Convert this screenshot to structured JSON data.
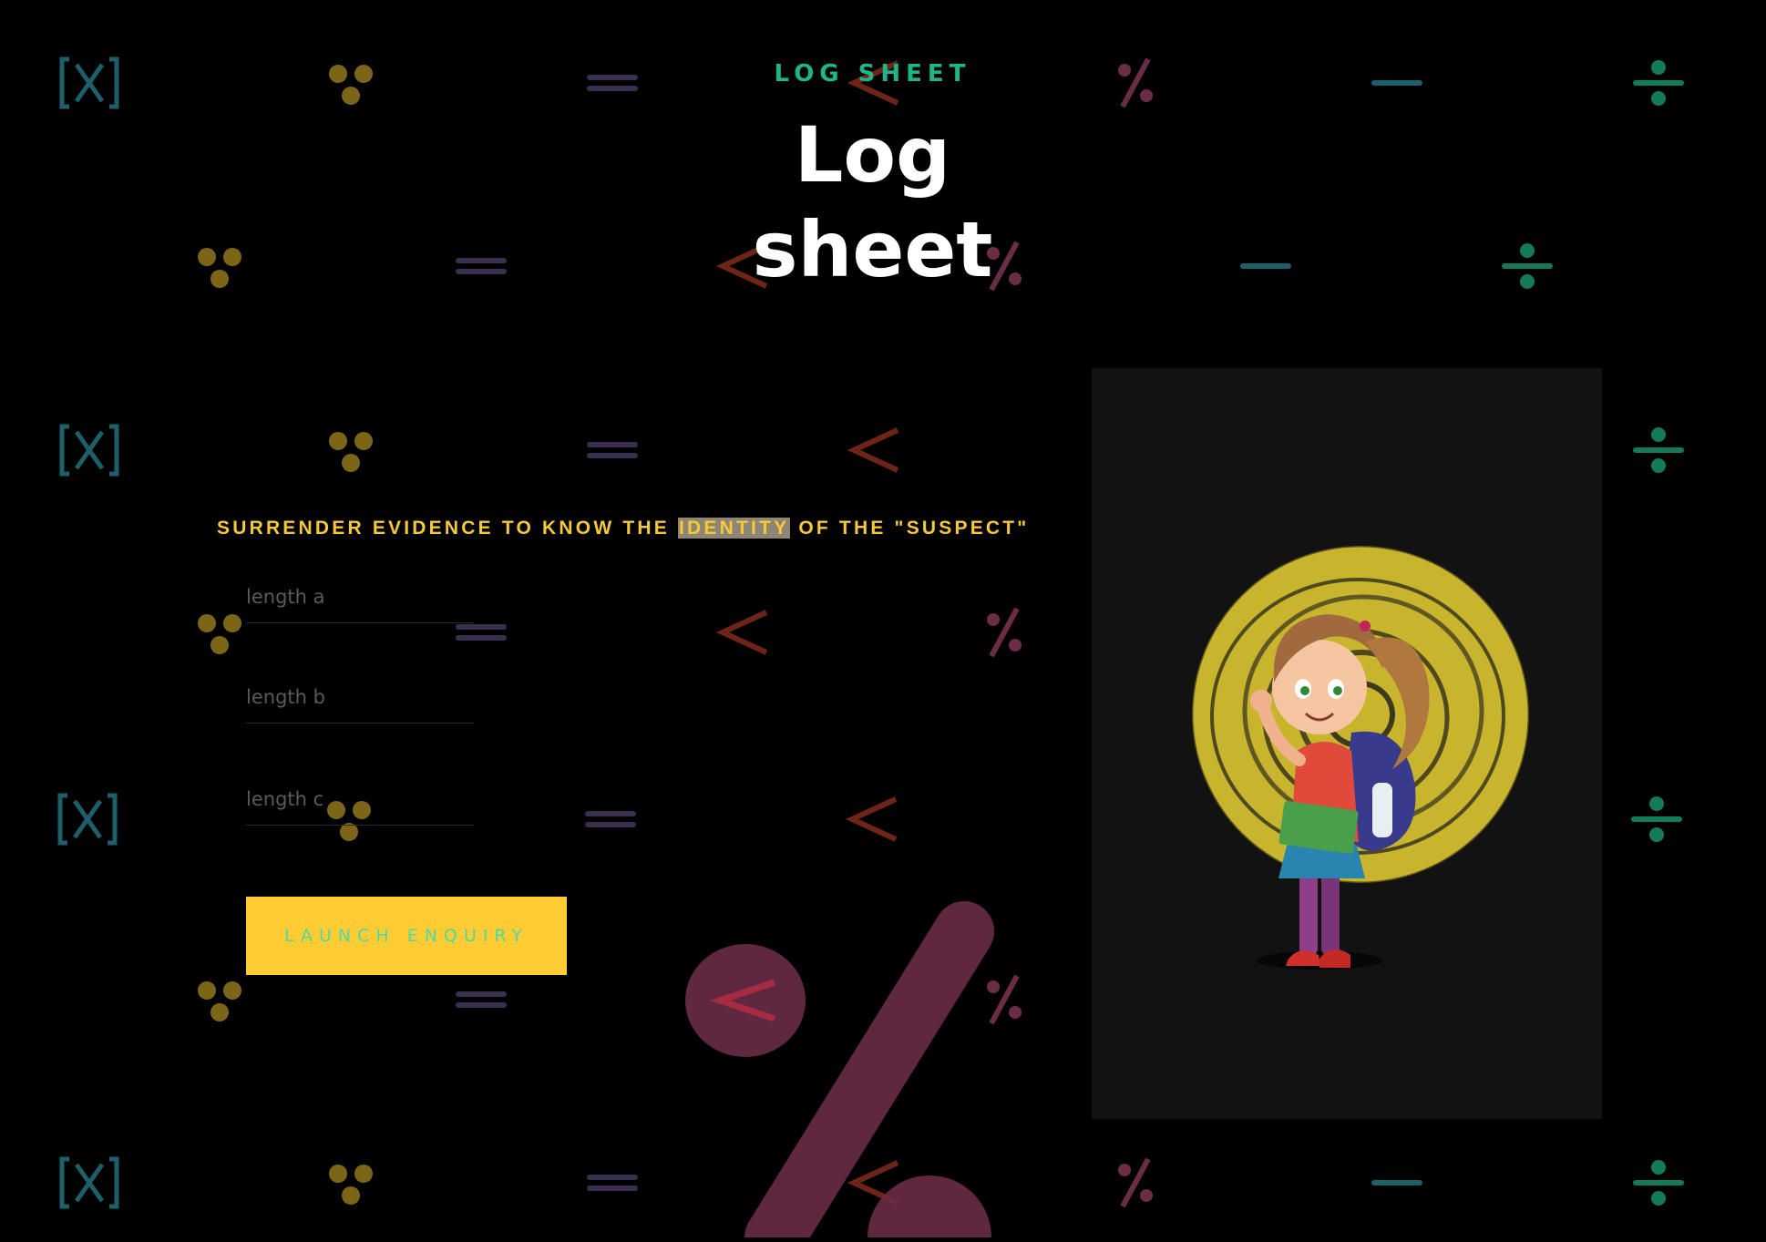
{
  "header": {
    "eyebrow": "LOG SHEET",
    "title_line1": "Log",
    "title_line2": "sheet"
  },
  "instruction": {
    "before": "SURRENDER EVIDENCE TO KNOW THE ",
    "highlight": "IDENTITY",
    "after": " OF THE \"SUSPECT\""
  },
  "form": {
    "length_a_placeholder": "length a",
    "length_b_placeholder": "length b",
    "length_c_placeholder": "length c",
    "submit_label": "Launch Enquiry"
  },
  "illustration": {
    "icon": "cartoon-girl-with-backpack-on-yellow-swirl"
  },
  "background": {
    "icons": [
      "bracket-x-icon",
      "therefore-dots-icon",
      "equals-icon",
      "less-than-icon",
      "percent-icon",
      "minus-icon",
      "divide-icon"
    ],
    "colors": {
      "teal": "#1d5f6a",
      "gold": "#7c6516",
      "purple": "#3a2f4f",
      "rust": "#6e2517",
      "mauve": "#6b2c48",
      "green": "#137a5a"
    }
  },
  "colors": {
    "accent_green": "#1fb58a",
    "accent_yellow": "#ffcd33",
    "instruction_text": "#f6c93a",
    "highlight_bg": "#8f8574"
  }
}
